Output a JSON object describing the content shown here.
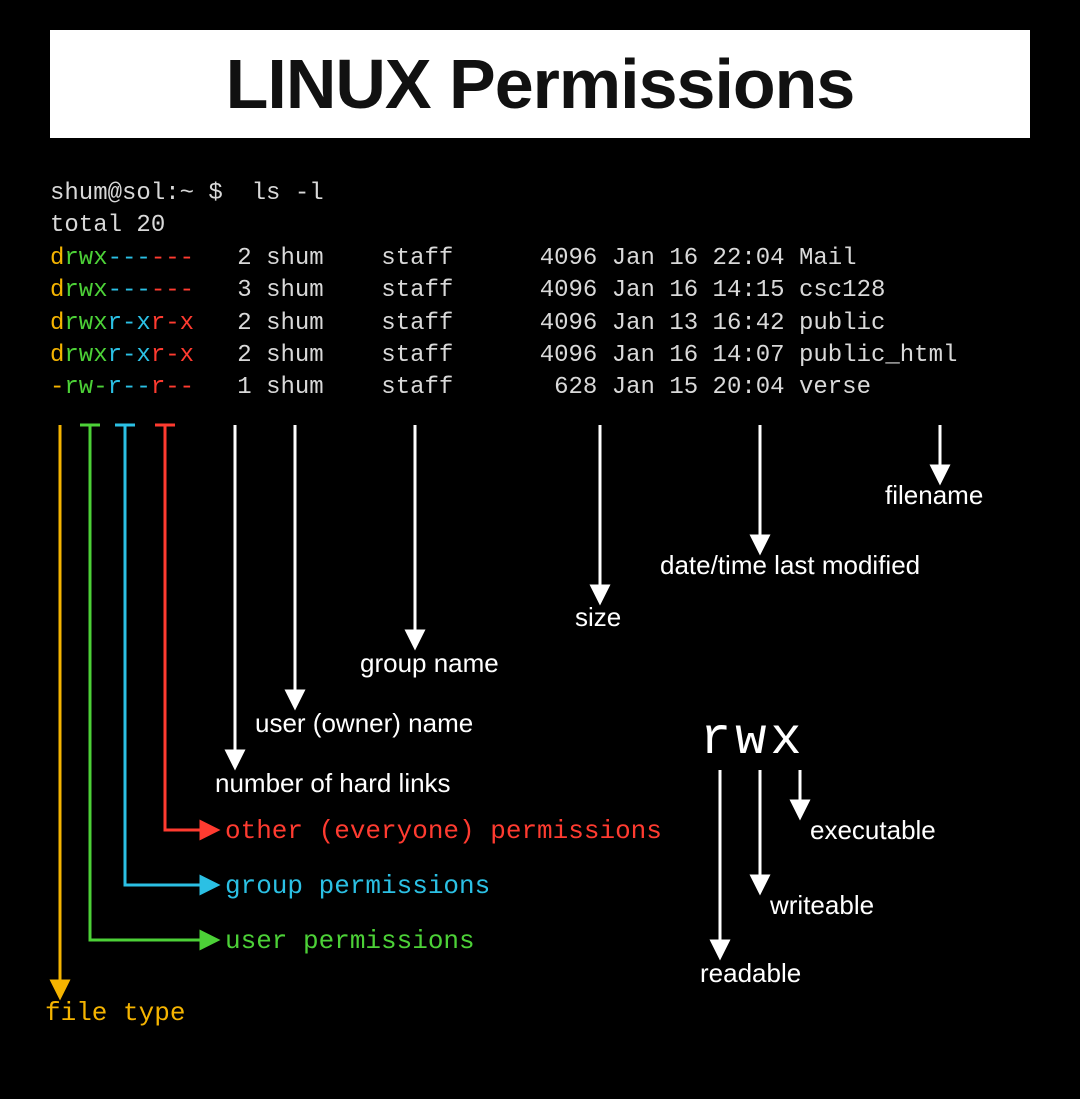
{
  "title": "LINUX Permissions",
  "prompt": "shum@sol:~ $  ls -l",
  "total": "total 20",
  "rows": [
    {
      "t": "d",
      "u": "rwx",
      "g": "---",
      "o": "---",
      "rest": "   2 shum    staff      4096 Jan 16 22:04 Mail"
    },
    {
      "t": "d",
      "u": "rwx",
      "g": "---",
      "o": "---",
      "rest": "   3 shum    staff      4096 Jan 16 14:15 csc128"
    },
    {
      "t": "d",
      "u": "rwx",
      "g": "r-x",
      "o": "r-x",
      "rest": "   2 shum    staff      4096 Jan 13 16:42 public"
    },
    {
      "t": "d",
      "u": "rwx",
      "g": "r-x",
      "o": "r-x",
      "rest": "   2 shum    staff      4096 Jan 16 14:07 public_html"
    },
    {
      "t": "-",
      "u": "rw-",
      "g": "r--",
      "o": "r--",
      "rest": "   1 shum    staff       628 Jan 15 20:04 verse"
    }
  ],
  "labels": {
    "filename": "filename",
    "datetime": "date/time last modified",
    "size": "size",
    "group": "group name",
    "owner": "user (owner) name",
    "hardlinks": "number of hard links",
    "other_perm": "other (everyone) permissions",
    "group_perm": "group permissions",
    "user_perm": "user permissions",
    "file_type": "file type"
  },
  "rwx": {
    "header": "rwx",
    "r": "readable",
    "w": "writeable",
    "x": "executable"
  }
}
